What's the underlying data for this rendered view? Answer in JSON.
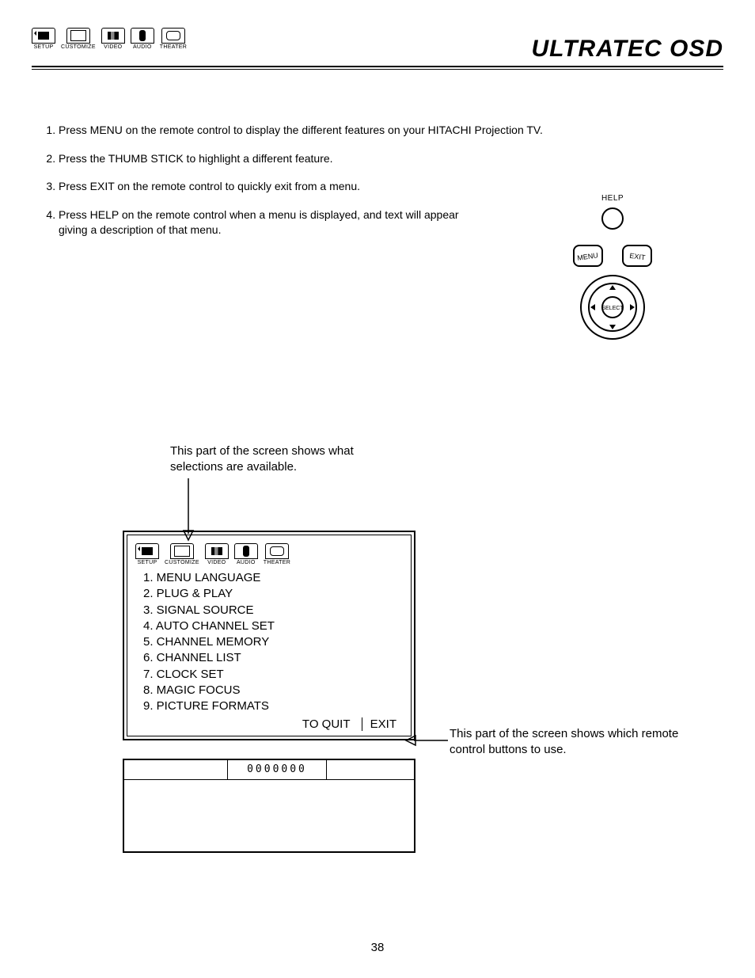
{
  "header": {
    "title": "ULTRATEC OSD"
  },
  "icon_labels": {
    "setup": "SETUP",
    "customize": "CUSTOMIZE",
    "video": "VIDEO",
    "audio": "AUDIO",
    "theater": "THEATER"
  },
  "instructions": {
    "item1": "Press MENU on the remote control to display the different features on your HITACHI Projection TV.",
    "item2": "Press the THUMB STICK to highlight a different feature.",
    "item3": "Press EXIT on the remote control to quickly exit from a menu.",
    "item4": "Press HELP on the remote control when a menu is displayed, and text will appear giving a description of that menu."
  },
  "remote": {
    "help": "HELP",
    "menu": "MENU",
    "exit": "EXIT",
    "select": "SELECT"
  },
  "osd": {
    "callout_top": "This part of the screen shows what selections are available.",
    "callout_right": "This part of the screen shows which remote control buttons to use.",
    "items": {
      "i1": "1. MENU LANGUAGE",
      "i2": "2. PLUG & PLAY",
      "i3": "3. SIGNAL SOURCE",
      "i4": "4. AUTO CHANNEL SET",
      "i5": "5. CHANNEL MEMORY",
      "i6": "6. CHANNEL LIST",
      "i7": "7. CLOCK SET",
      "i8": "8. MAGIC FOCUS",
      "i9": "9. PICTURE FORMATS"
    },
    "footer": {
      "to_quit": "TO QUIT",
      "exit": "EXIT"
    },
    "deck_display": "0000000"
  },
  "page_number": "38"
}
